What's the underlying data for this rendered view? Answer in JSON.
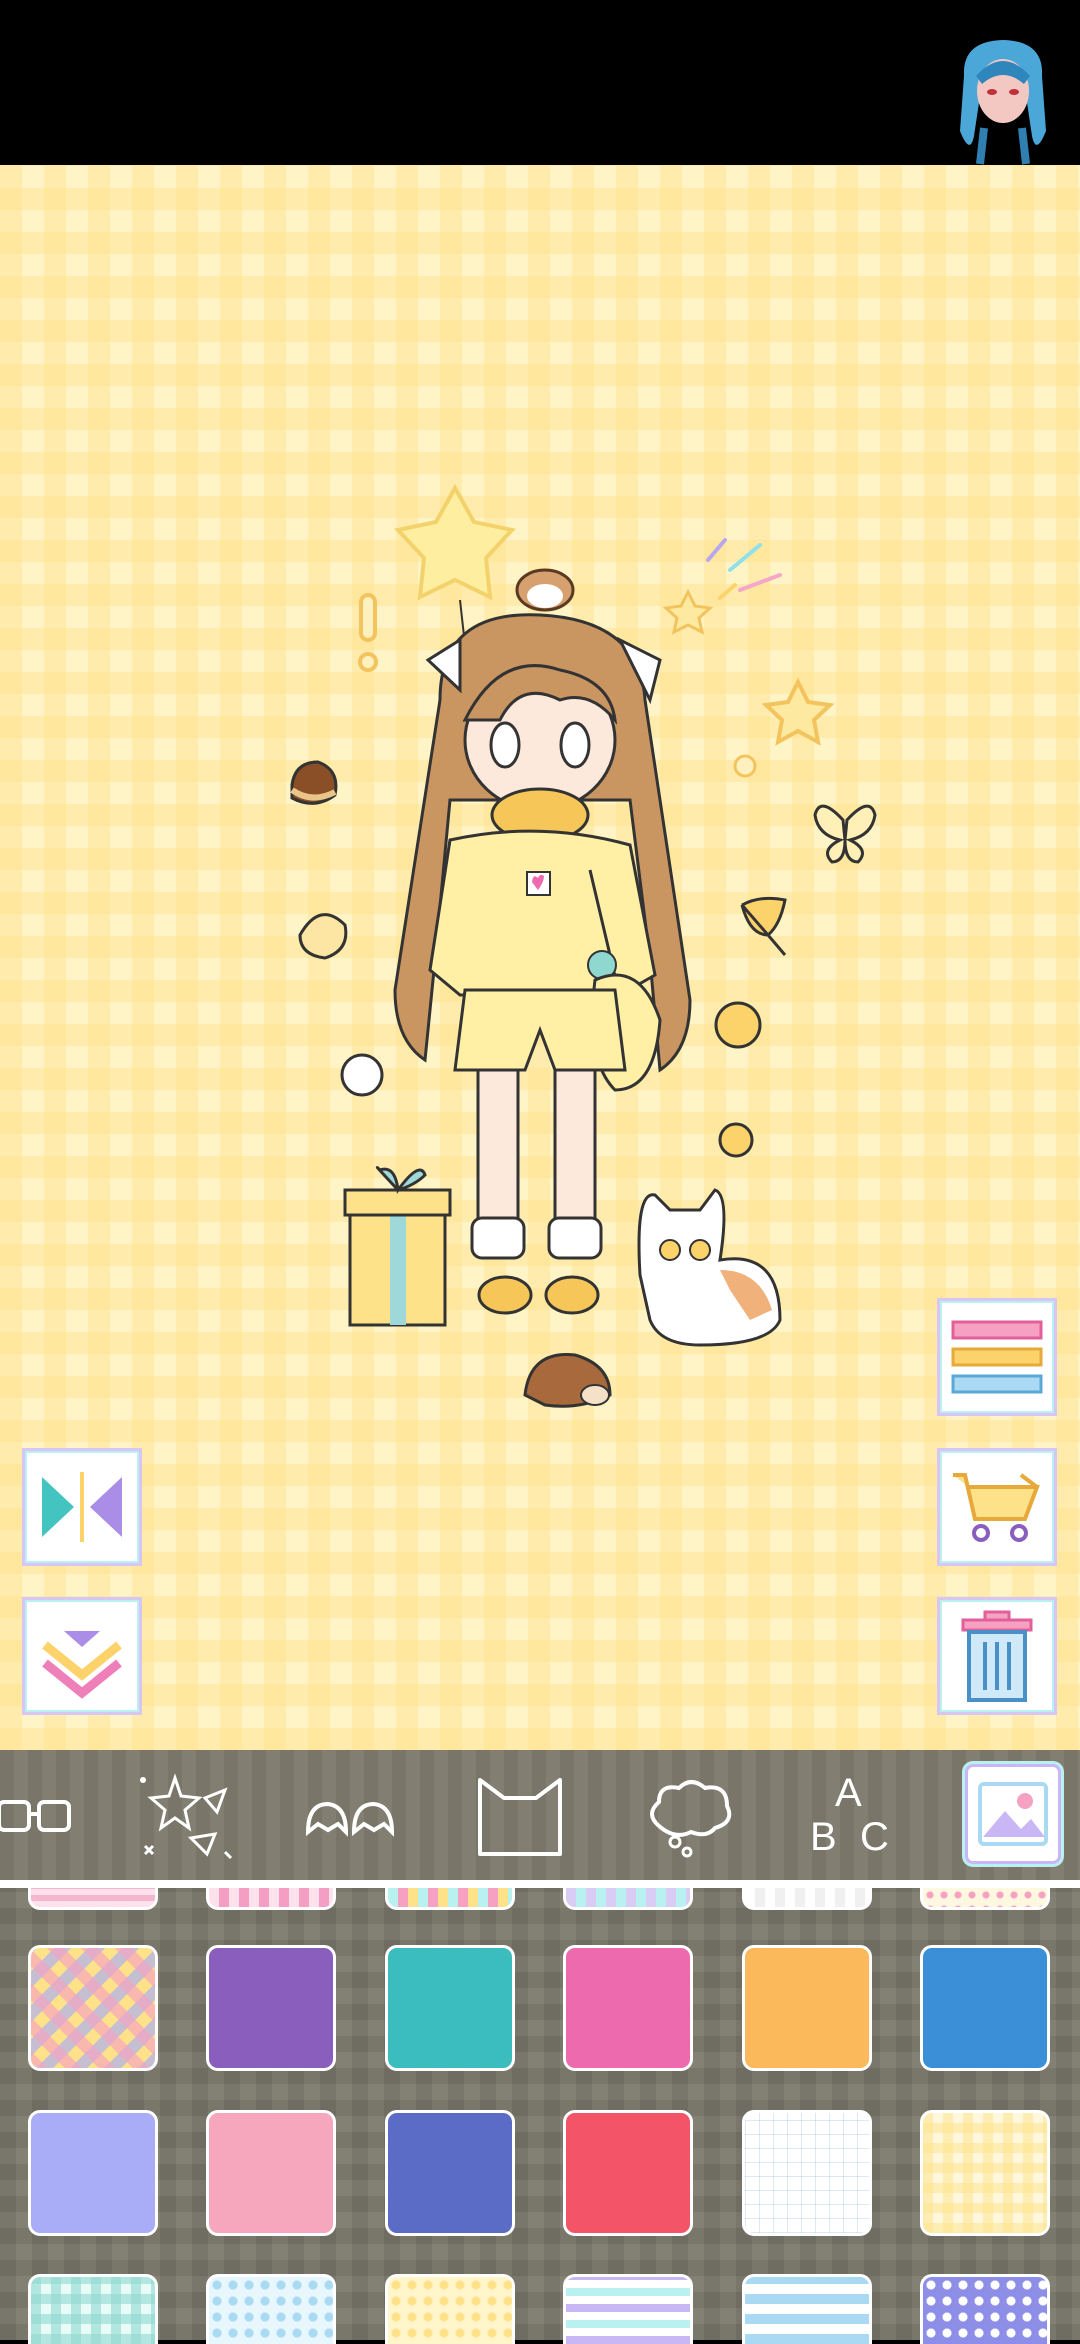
{
  "status_bar": {
    "avatar_icon": "character-avatar-icon"
  },
  "canvas": {
    "background": "yellow-gingham",
    "exclamation": "!",
    "side_buttons_left": [
      {
        "name": "flip-button",
        "icon": "mirror-flip-icon"
      },
      {
        "name": "collapse-button",
        "icon": "chevron-down-icon"
      }
    ],
    "side_buttons_right": [
      {
        "name": "layers-button",
        "icon": "layers-icon"
      },
      {
        "name": "shop-button",
        "icon": "cart-icon"
      },
      {
        "name": "delete-button",
        "icon": "trash-icon"
      }
    ]
  },
  "toolbar": {
    "tabs": [
      {
        "name": "tab-glasses",
        "icon": "glasses-icon"
      },
      {
        "name": "tab-sparkles",
        "icon": "sparkles-icon"
      },
      {
        "name": "tab-hair",
        "icon": "hair-icon"
      },
      {
        "name": "tab-cat-ears",
        "icon": "cat-head-icon"
      },
      {
        "name": "tab-thought",
        "icon": "thought-bubble-icon"
      },
      {
        "name": "tab-text",
        "icon": "text-icon",
        "letters": [
          "A",
          "B",
          "C"
        ]
      },
      {
        "name": "tab-background",
        "icon": "image-icon",
        "selected": true
      }
    ]
  },
  "palette": {
    "top_partial_row": [
      "pink-stripe",
      "pink-wave",
      "triangle-pastel",
      "triangle-lilac",
      "white-zigzag",
      "dots-pastel"
    ],
    "row1": [
      {
        "kind": "pattern",
        "pattern": "plaid-rainbow"
      },
      {
        "kind": "solid",
        "color": "#8a5ebd"
      },
      {
        "kind": "solid",
        "color": "#3bbcbf"
      },
      {
        "kind": "solid",
        "color": "#ee6aaf"
      },
      {
        "kind": "solid",
        "color": "#fbb95b"
      },
      {
        "kind": "solid",
        "color": "#3a8fd6"
      }
    ],
    "row2": [
      {
        "kind": "solid",
        "color": "#a9acf7"
      },
      {
        "kind": "solid",
        "color": "#f6a6bd"
      },
      {
        "kind": "solid",
        "color": "#5a6cc6"
      },
      {
        "kind": "solid",
        "color": "#f35468"
      },
      {
        "kind": "pattern",
        "pattern": "grid-white"
      },
      {
        "kind": "pattern",
        "pattern": "gingham-yellow"
      }
    ],
    "bottom_partial_row": [
      "gingham-mint",
      "dots-blue",
      "dots-yellow",
      "wave-pastel",
      "wave-blue",
      "dots-purple"
    ],
    "colors": {
      "toolbar_bg": "#7e7b6d",
      "palette_bg": "#7b786b",
      "canvas_bg": "#fff4c6"
    }
  }
}
